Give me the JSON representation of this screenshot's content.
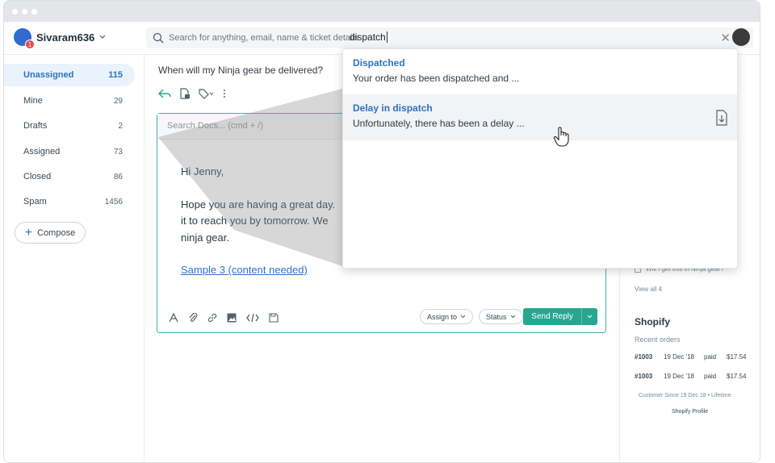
{
  "window": {
    "accent": "#27a78f",
    "link_color": "#2f72c4"
  },
  "header": {
    "org_name": "Sivaram636",
    "org_badge": "1",
    "search_placeholder": "Search for anything, email, name & ticket details",
    "search_query": "dispatch",
    "close_symbol": "✕"
  },
  "sidebar": {
    "items": [
      {
        "label": "Unassigned",
        "count": "115"
      },
      {
        "label": "Mine",
        "count": "29"
      },
      {
        "label": "Drafts",
        "count": "2"
      },
      {
        "label": "Assigned",
        "count": "73"
      },
      {
        "label": "Closed",
        "count": "86"
      },
      {
        "label": "Spam",
        "count": "1456"
      }
    ],
    "compose_label": "Compose"
  },
  "ticket": {
    "subject": "When will my Ninja gear be delivered?",
    "docs_search_placeholder": "Search Docs... (cmd + /)",
    "greeting": "Hi Jenny,",
    "body_line1": "Hope you are having a great day.",
    "body_line2": "it to reach you by tomorrow. We",
    "body_line3": "ninja gear.",
    "link_text": "Sample 3 (content needed)",
    "assign_label": "Assign to",
    "status_label": "Status",
    "send_label": "Send Reply"
  },
  "dropdown": {
    "results": [
      {
        "title": "Dispatched",
        "snippet": "Your order has been dispatched and ..."
      },
      {
        "title": "Delay in dispatch",
        "snippet": "Unfortunately, there has been a delay ..."
      }
    ]
  },
  "right_panel": {
    "faded_item": "Will I get this in Ninja gear?",
    "view_all": "View all 4",
    "shopify_title": "Shopify",
    "recent_orders": "Recent orders",
    "orders": [
      {
        "id": "#1003",
        "date": "19 Dec '18",
        "status": "paid",
        "amount": "$17.54"
      },
      {
        "id": "#1003",
        "date": "19 Dec '18",
        "status": "paid",
        "amount": "$17.54"
      }
    ],
    "customer_since": "Customer Since 19 Dec 18 • Lifetime",
    "profile_link": "Shopify Profile"
  }
}
